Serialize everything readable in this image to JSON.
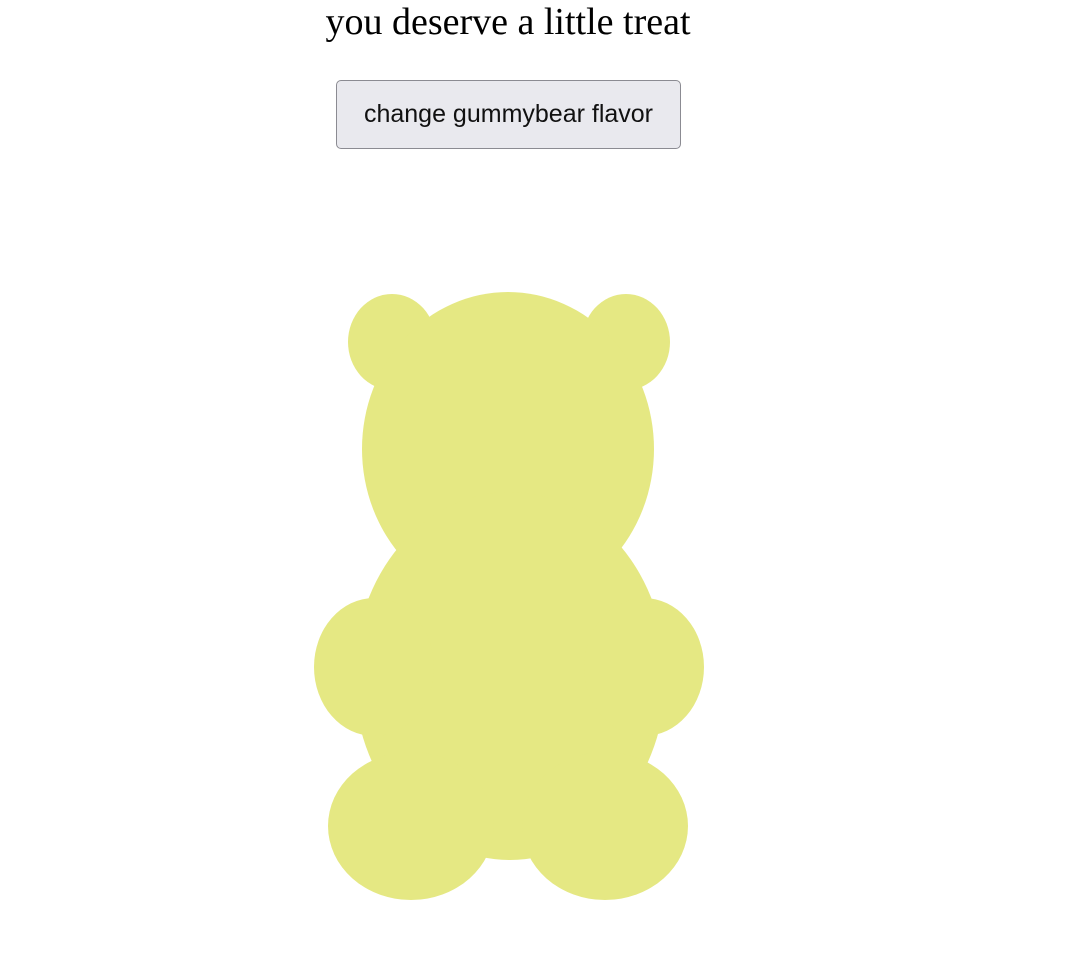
{
  "page": {
    "heading": "you deserve a little treat",
    "button_label": "change gummybear flavor"
  },
  "bear": {
    "color": "#e5e883"
  }
}
